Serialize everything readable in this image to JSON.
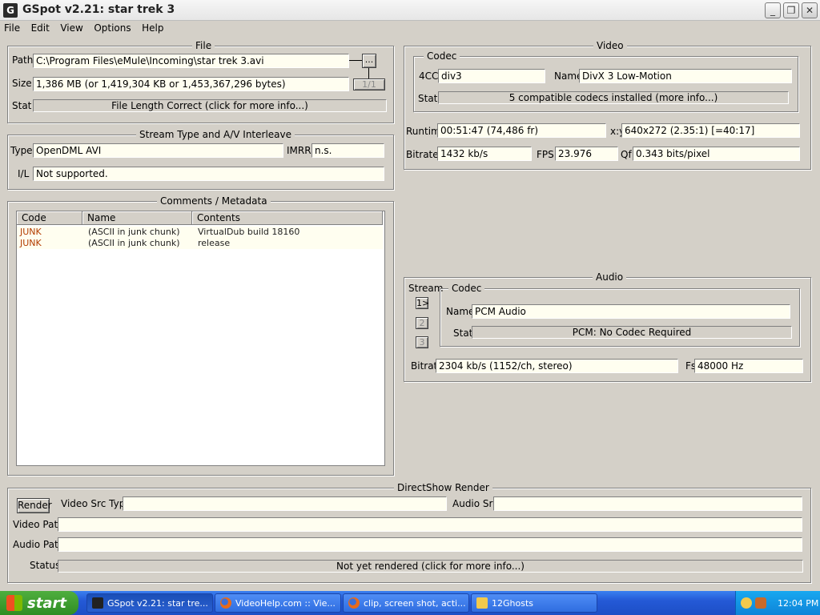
{
  "window": {
    "title": "GSpot v2.21: star trek 3",
    "app_icon": "gspot-icon",
    "controls": {
      "minimize": "_",
      "maximize": "❐",
      "close": "✕"
    }
  },
  "menu": [
    "File",
    "Edit",
    "View",
    "Options",
    "Help"
  ],
  "file": {
    "title": "File",
    "path_label": "Path",
    "path": "C:\\Program Files\\eMule\\Incoming\\star trek 3.avi",
    "browse_label": "...",
    "size_label": "Size",
    "size": "1,386 MB (or 1,419,304 KB or 1,453,367,296 bytes)",
    "page_label": "1/1",
    "stat_label": "Stat",
    "stat": "File Length Correct (click for more info...)"
  },
  "stream": {
    "title": "Stream Type and A/V Interleave",
    "type_label": "Type",
    "type": "OpenDML AVI",
    "imrr_label": "IMRR",
    "imrr": "n.s.",
    "il_label": "I/L",
    "il": "Not supported."
  },
  "comments": {
    "title": "Comments / Metadata",
    "columns": [
      "Code",
      "Name",
      "Contents"
    ],
    "rows": [
      {
        "code": "JUNK",
        "name": "(ASCII in junk chunk)",
        "contents": "VirtualDub build 18160"
      },
      {
        "code": "JUNK",
        "name": "(ASCII in junk chunk)",
        "contents": "release"
      }
    ]
  },
  "video": {
    "title": "Video",
    "codec_title": "Codec",
    "fourcc_label": "4CC",
    "fourcc": "div3",
    "name_label": "Name",
    "name": "DivX 3 Low-Motion",
    "stat_label": "Stat",
    "stat": "5 compatible codecs installed (more info...)",
    "runtime_label": "Runtime",
    "runtime": "00:51:47 (74,486 fr)",
    "xy_label": "x:y",
    "xy": "640x272 (2.35:1) [=40:17]",
    "bitrate_label": "Bitrate",
    "bitrate": "1432 kb/s",
    "fps_label": "FPS",
    "fps": "23.976",
    "qf_label": "Qf",
    "qf": "0.343 bits/pixel"
  },
  "audio": {
    "title": "Audio",
    "stream_label": "Stream",
    "streams": [
      "1>",
      "2",
      "3"
    ],
    "codec_title": "Codec",
    "name_label": "Name",
    "name": "PCM Audio",
    "stat_label": "Stat",
    "stat": "PCM: No Codec Required",
    "bitrate_label": "Bitrate",
    "bitrate": "2304 kb/s (1152/ch, stereo)",
    "fs_label": "Fs",
    "fs": "48000 Hz"
  },
  "directshow": {
    "title": "DirectShow Render",
    "render_label": "Render",
    "video_src_type_label": "Video Src Type",
    "video_src_type": "",
    "audio_src_label": "Audio Src",
    "audio_src": "",
    "video_path_label": "Video Path",
    "video_path": "",
    "audio_path_label": "Audio Path",
    "audio_path": "",
    "status_label": "Status",
    "status": "Not yet rendered (click for more info...)"
  },
  "taskbar": {
    "start_label": "start",
    "tasks": [
      {
        "label": "GSpot v2.21: star tre...",
        "icon": "gspot-icon",
        "color": "#222222"
      },
      {
        "label": "VideoHelp.com :: Vie...",
        "icon": "firefox-icon",
        "color": "#e86a1a"
      },
      {
        "label": "clip, screen shot, acti...",
        "icon": "firefox-icon",
        "color": "#e86a1a"
      },
      {
        "label": "12Ghosts",
        "icon": "folder-icon",
        "color": "#f2c94c"
      }
    ],
    "clock": "12:04 PM"
  }
}
